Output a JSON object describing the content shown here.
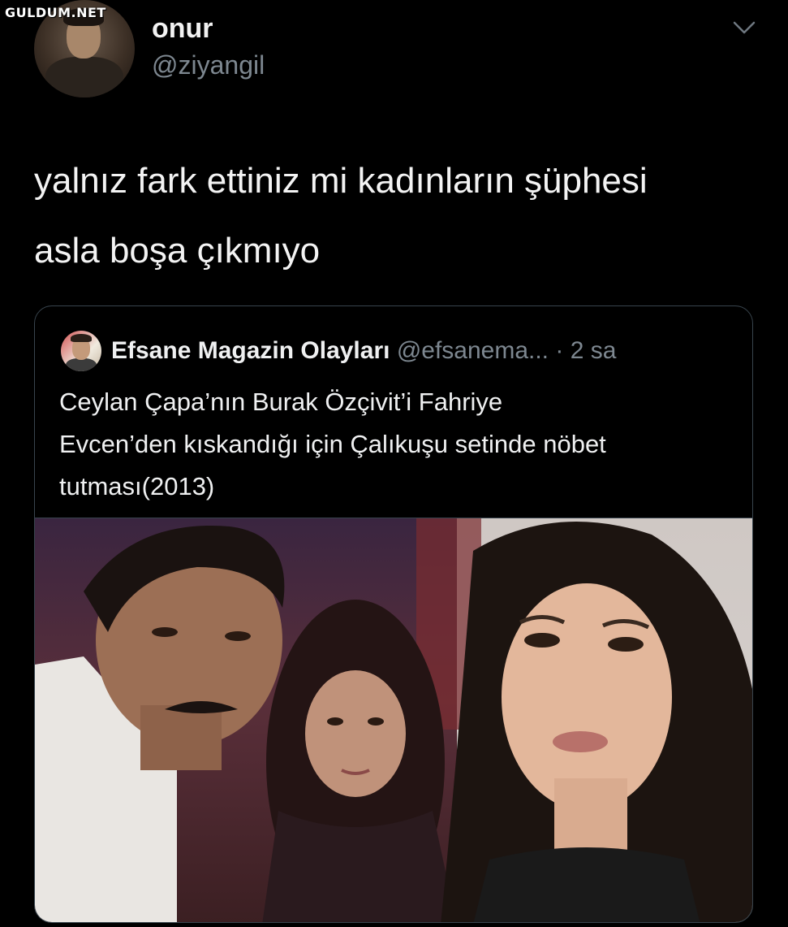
{
  "watermark": "GULDUM.NET",
  "tweet": {
    "display_name": "onur",
    "handle": "@ziyangil",
    "text": "yalnız fark ettiniz mi kadınların şüphesi\nasla boşa çıkmıyo"
  },
  "quoted_tweet": {
    "display_name": "Efsane Magazin Olayları",
    "handle": "@efsanema...",
    "separator": "·",
    "time": "2 sa",
    "text": "Ceylan Çapa’nın Burak Özçivit’i Fahriye\nEvcen’den kıskandığı için Çalıkuşu setinde nöbet\ntutması(2013)"
  },
  "icons": {
    "menu": "chevron-down-icon"
  },
  "colors": {
    "background": "#000000",
    "secondary_text": "#7d8790",
    "border": "#38444d"
  }
}
